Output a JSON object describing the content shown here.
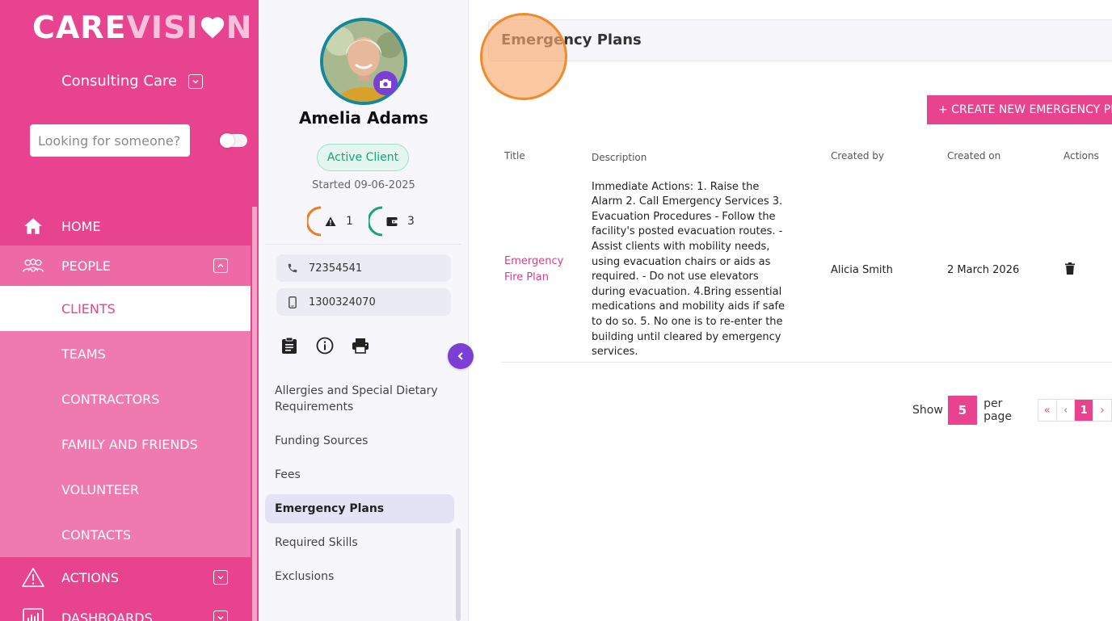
{
  "app": {
    "logo_part1": "CARE",
    "logo_part2": "VISI",
    "logo_part3": "N",
    "org_name": "Consulting Care",
    "brand_color": "#e8438e",
    "accent_purple": "#7b3fd6"
  },
  "search": {
    "placeholder": "Looking for someone?"
  },
  "sidebar": {
    "home": "HOME",
    "people": "PEOPLE",
    "people_sub": [
      "CLIENTS",
      "TEAMS",
      "CONTRACTORS",
      "FAMILY AND FRIENDS",
      "VOLUNTEER",
      "CONTACTS"
    ],
    "actions": "ACTIONS",
    "dashboards": "DASHBOARDS"
  },
  "client": {
    "name": "Amelia Adams",
    "status": "Active Client",
    "started": "Started 09-06-2025",
    "alerts_count": "1",
    "wallet_count": "3",
    "phone": "72354541",
    "mobile": "1300324070",
    "menu": [
      "Allergies and Special Dietary Requirements",
      "Funding Sources",
      "Fees",
      "Emergency Plans",
      "Required Skills",
      "Exclusions"
    ],
    "active_menu": "Emergency Plans"
  },
  "main": {
    "title": "Emergency Plans",
    "create_button": "+ CREATE NEW EMERGENCY PLAN",
    "table": {
      "headers": [
        "Title",
        "Description",
        "Created by",
        "Created on",
        "Actions"
      ],
      "rows": [
        {
          "title": "Emergency Fire Plan",
          "description": "Immediate Actions: 1. Raise the Alarm 2. Call Emergency Services 3. Evacuation Procedures - Follow the facility's posted evacuation routes. - Assist clients with mobility needs, using evacuation chairs or aids as required. - Do not use elevators during evacuation. 4.Bring essential medications and mobility aids if safe to do so. 5. No one is to re-enter the building until cleared by emergency services.",
          "created_by": "Alicia Smith",
          "created_on": "2 March 2026"
        }
      ]
    },
    "pagination": {
      "show_label": "Show",
      "page_size": "5",
      "per_page_label": "per page",
      "first": "«",
      "prev": "‹",
      "current_page": "1",
      "next": "›"
    }
  }
}
